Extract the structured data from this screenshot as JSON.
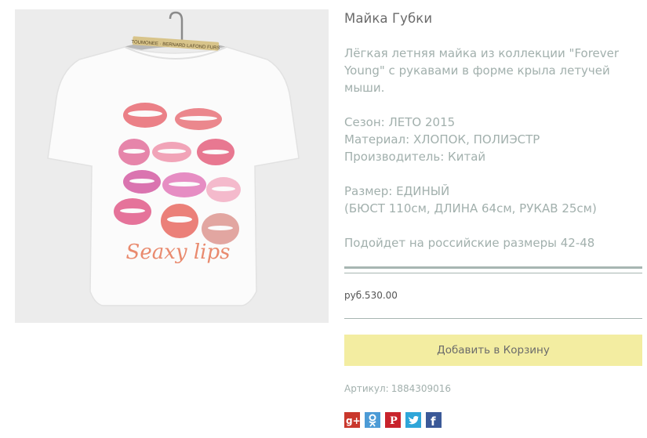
{
  "product": {
    "title": "Майка Губки",
    "description": "Лёгкая летняя майка из коллекции \"Forever Young\" с рукавами в форме крыла летучей мыши.",
    "season": "Сезон: ЛЕТО 2015",
    "material": "Материал: ХЛОПОК, ПОЛИЭСТР",
    "manufacturer": "Производитель: Китай",
    "size": "Размер: ЕДИНЫЙ",
    "measurements": "(БЮСТ 110см, ДЛИНА 64см, РУКАВ 25см)",
    "fit_note": "Подойдет на российские размеры 42-48",
    "price": "руб.530.00",
    "add_to_cart_label": "Добавить в Корзину",
    "sku_label": "Артикул:",
    "sku_value": "1884309016"
  },
  "image": {
    "hanger_tag_text": "TOUMONEE · BERNARD LAFOND FURS",
    "print_text": "Seaxy lips"
  },
  "share": [
    {
      "name": "google-plus-icon",
      "glyph": "g+",
      "color": "#c9372c"
    },
    {
      "name": "odnoklassniki-icon",
      "glyph": "ok",
      "color": "#4c9bd6"
    },
    {
      "name": "pinterest-icon",
      "glyph": "P",
      "color": "#c8232c"
    },
    {
      "name": "twitter-icon",
      "glyph": "t",
      "color": "#2fa6d9"
    },
    {
      "name": "facebook-icon",
      "glyph": "f",
      "color": "#3b5998"
    }
  ]
}
